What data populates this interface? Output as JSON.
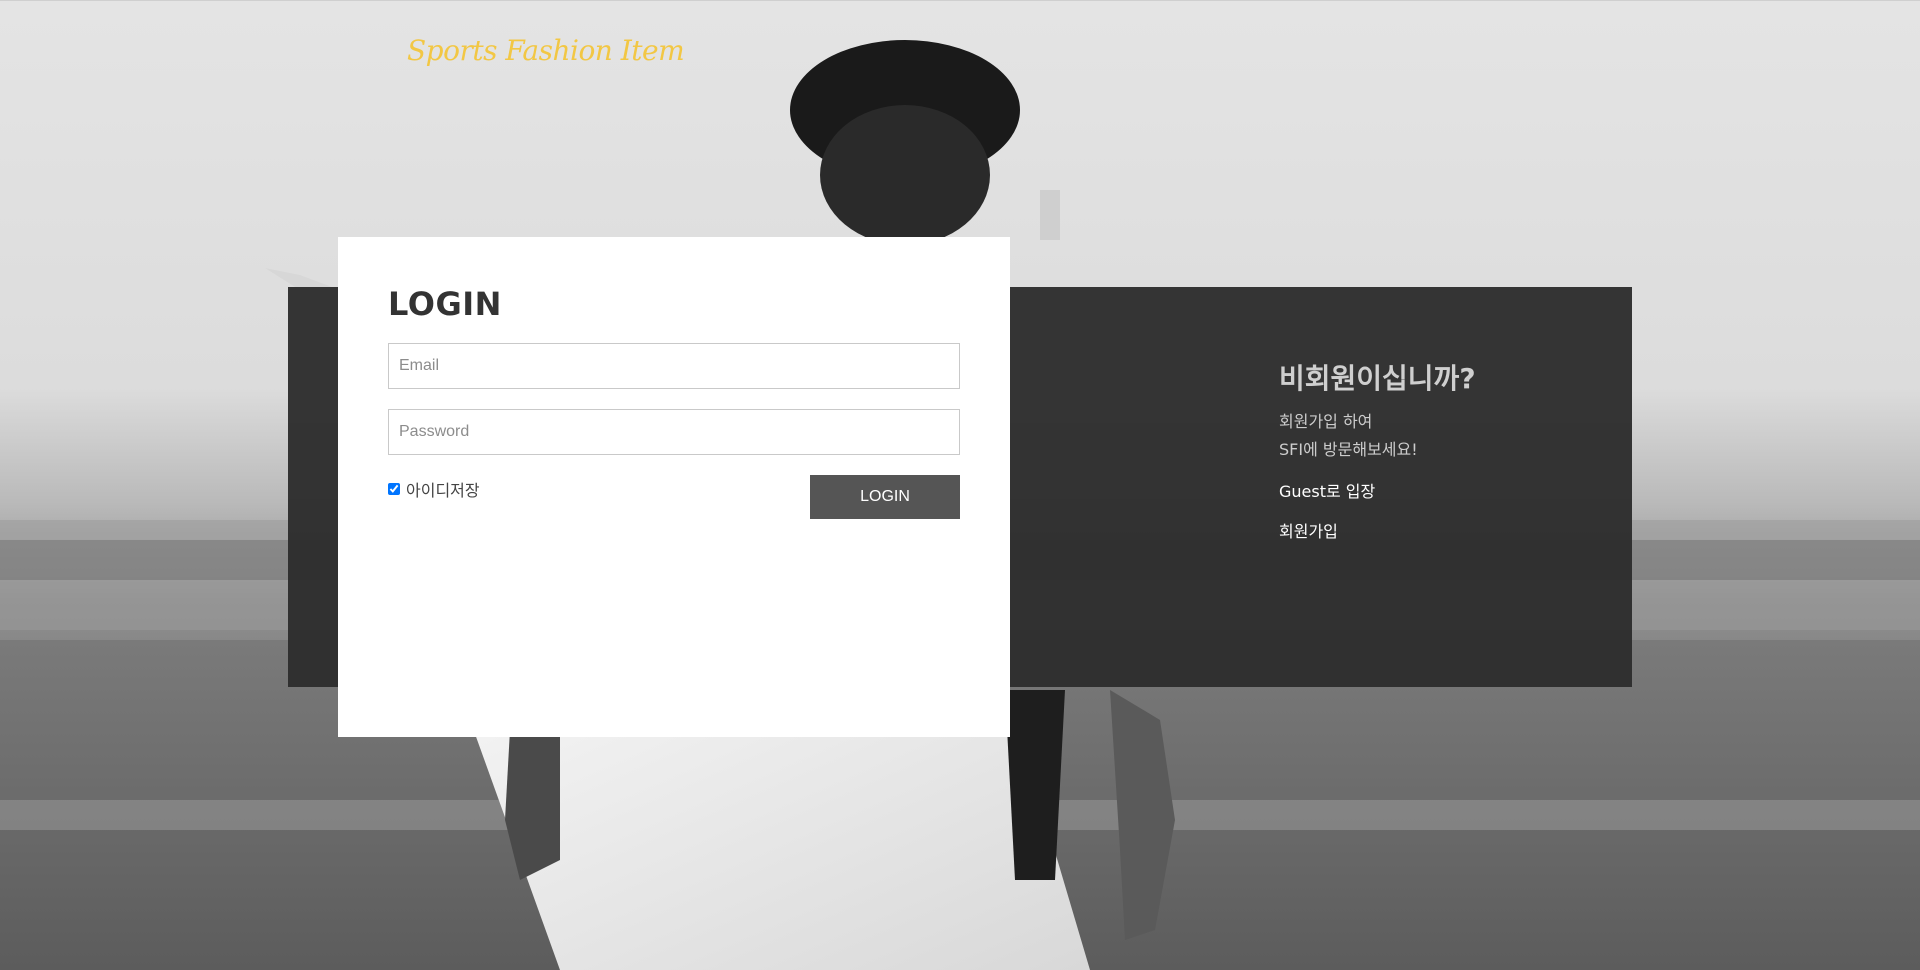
{
  "brand": {
    "logo_text": "Sports Fashion Item",
    "logo_color": "#f2c744"
  },
  "login": {
    "title": "LOGIN",
    "email_placeholder": "Email",
    "email_value": "",
    "password_placeholder": "Password",
    "password_value": "",
    "remember_label": "아이디저장",
    "remember_checked": true,
    "submit_label": "LOGIN"
  },
  "guest": {
    "title": "비회원이십니까?",
    "desc_line1": "회원가입 하여",
    "desc_line2": "SFI에 방문해보세요!",
    "guest_entry_label": "Guest로 입장",
    "signup_label": "회원가입"
  },
  "colors": {
    "panel_bg": "#2d2d2d",
    "button_bg": "#555555",
    "card_bg": "#ffffff"
  }
}
